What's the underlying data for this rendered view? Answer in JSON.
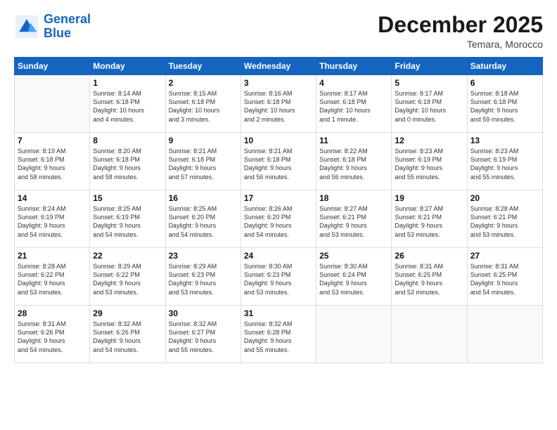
{
  "logo": {
    "line1": "General",
    "line2": "Blue"
  },
  "title": "December 2025",
  "location": "Temara, Morocco",
  "days_of_week": [
    "Sunday",
    "Monday",
    "Tuesday",
    "Wednesday",
    "Thursday",
    "Friday",
    "Saturday"
  ],
  "weeks": [
    [
      {
        "day": "",
        "info": ""
      },
      {
        "day": "1",
        "info": "Sunrise: 8:14 AM\nSunset: 6:18 PM\nDaylight: 10 hours\nand 4 minutes."
      },
      {
        "day": "2",
        "info": "Sunrise: 8:15 AM\nSunset: 6:18 PM\nDaylight: 10 hours\nand 3 minutes."
      },
      {
        "day": "3",
        "info": "Sunrise: 8:16 AM\nSunset: 6:18 PM\nDaylight: 10 hours\nand 2 minutes."
      },
      {
        "day": "4",
        "info": "Sunrise: 8:17 AM\nSunset: 6:18 PM\nDaylight: 10 hours\nand 1 minute."
      },
      {
        "day": "5",
        "info": "Sunrise: 8:17 AM\nSunset: 6:18 PM\nDaylight: 10 hours\nand 0 minutes."
      },
      {
        "day": "6",
        "info": "Sunrise: 8:18 AM\nSunset: 6:18 PM\nDaylight: 9 hours\nand 59 minutes."
      }
    ],
    [
      {
        "day": "7",
        "info": "Sunrise: 8:19 AM\nSunset: 6:18 PM\nDaylight: 9 hours\nand 58 minutes."
      },
      {
        "day": "8",
        "info": "Sunrise: 8:20 AM\nSunset: 6:18 PM\nDaylight: 9 hours\nand 58 minutes."
      },
      {
        "day": "9",
        "info": "Sunrise: 8:21 AM\nSunset: 6:18 PM\nDaylight: 9 hours\nand 57 minutes."
      },
      {
        "day": "10",
        "info": "Sunrise: 8:21 AM\nSunset: 6:18 PM\nDaylight: 9 hours\nand 56 minutes."
      },
      {
        "day": "11",
        "info": "Sunrise: 8:22 AM\nSunset: 6:18 PM\nDaylight: 9 hours\nand 56 minutes."
      },
      {
        "day": "12",
        "info": "Sunrise: 8:23 AM\nSunset: 6:19 PM\nDaylight: 9 hours\nand 55 minutes."
      },
      {
        "day": "13",
        "info": "Sunrise: 8:23 AM\nSunset: 6:19 PM\nDaylight: 9 hours\nand 55 minutes."
      }
    ],
    [
      {
        "day": "14",
        "info": "Sunrise: 8:24 AM\nSunset: 6:19 PM\nDaylight: 9 hours\nand 54 minutes."
      },
      {
        "day": "15",
        "info": "Sunrise: 8:25 AM\nSunset: 6:19 PM\nDaylight: 9 hours\nand 54 minutes."
      },
      {
        "day": "16",
        "info": "Sunrise: 8:25 AM\nSunset: 6:20 PM\nDaylight: 9 hours\nand 54 minutes."
      },
      {
        "day": "17",
        "info": "Sunrise: 8:26 AM\nSunset: 6:20 PM\nDaylight: 9 hours\nand 54 minutes."
      },
      {
        "day": "18",
        "info": "Sunrise: 8:27 AM\nSunset: 6:21 PM\nDaylight: 9 hours\nand 53 minutes."
      },
      {
        "day": "19",
        "info": "Sunrise: 8:27 AM\nSunset: 6:21 PM\nDaylight: 9 hours\nand 53 minutes."
      },
      {
        "day": "20",
        "info": "Sunrise: 8:28 AM\nSunset: 6:21 PM\nDaylight: 9 hours\nand 53 minutes."
      }
    ],
    [
      {
        "day": "21",
        "info": "Sunrise: 8:28 AM\nSunset: 6:22 PM\nDaylight: 9 hours\nand 53 minutes."
      },
      {
        "day": "22",
        "info": "Sunrise: 8:29 AM\nSunset: 6:22 PM\nDaylight: 9 hours\nand 53 minutes."
      },
      {
        "day": "23",
        "info": "Sunrise: 8:29 AM\nSunset: 6:23 PM\nDaylight: 9 hours\nand 53 minutes."
      },
      {
        "day": "24",
        "info": "Sunrise: 8:30 AM\nSunset: 6:23 PM\nDaylight: 9 hours\nand 53 minutes."
      },
      {
        "day": "25",
        "info": "Sunrise: 8:30 AM\nSunset: 6:24 PM\nDaylight: 9 hours\nand 53 minutes."
      },
      {
        "day": "26",
        "info": "Sunrise: 8:31 AM\nSunset: 6:25 PM\nDaylight: 9 hours\nand 53 minutes."
      },
      {
        "day": "27",
        "info": "Sunrise: 8:31 AM\nSunset: 6:25 PM\nDaylight: 9 hours\nand 54 minutes."
      }
    ],
    [
      {
        "day": "28",
        "info": "Sunrise: 8:31 AM\nSunset: 6:26 PM\nDaylight: 9 hours\nand 54 minutes."
      },
      {
        "day": "29",
        "info": "Sunrise: 8:32 AM\nSunset: 6:26 PM\nDaylight: 9 hours\nand 54 minutes."
      },
      {
        "day": "30",
        "info": "Sunrise: 8:32 AM\nSunset: 6:27 PM\nDaylight: 9 hours\nand 55 minutes."
      },
      {
        "day": "31",
        "info": "Sunrise: 8:32 AM\nSunset: 6:28 PM\nDaylight: 9 hours\nand 55 minutes."
      },
      {
        "day": "",
        "info": ""
      },
      {
        "day": "",
        "info": ""
      },
      {
        "day": "",
        "info": ""
      }
    ]
  ]
}
